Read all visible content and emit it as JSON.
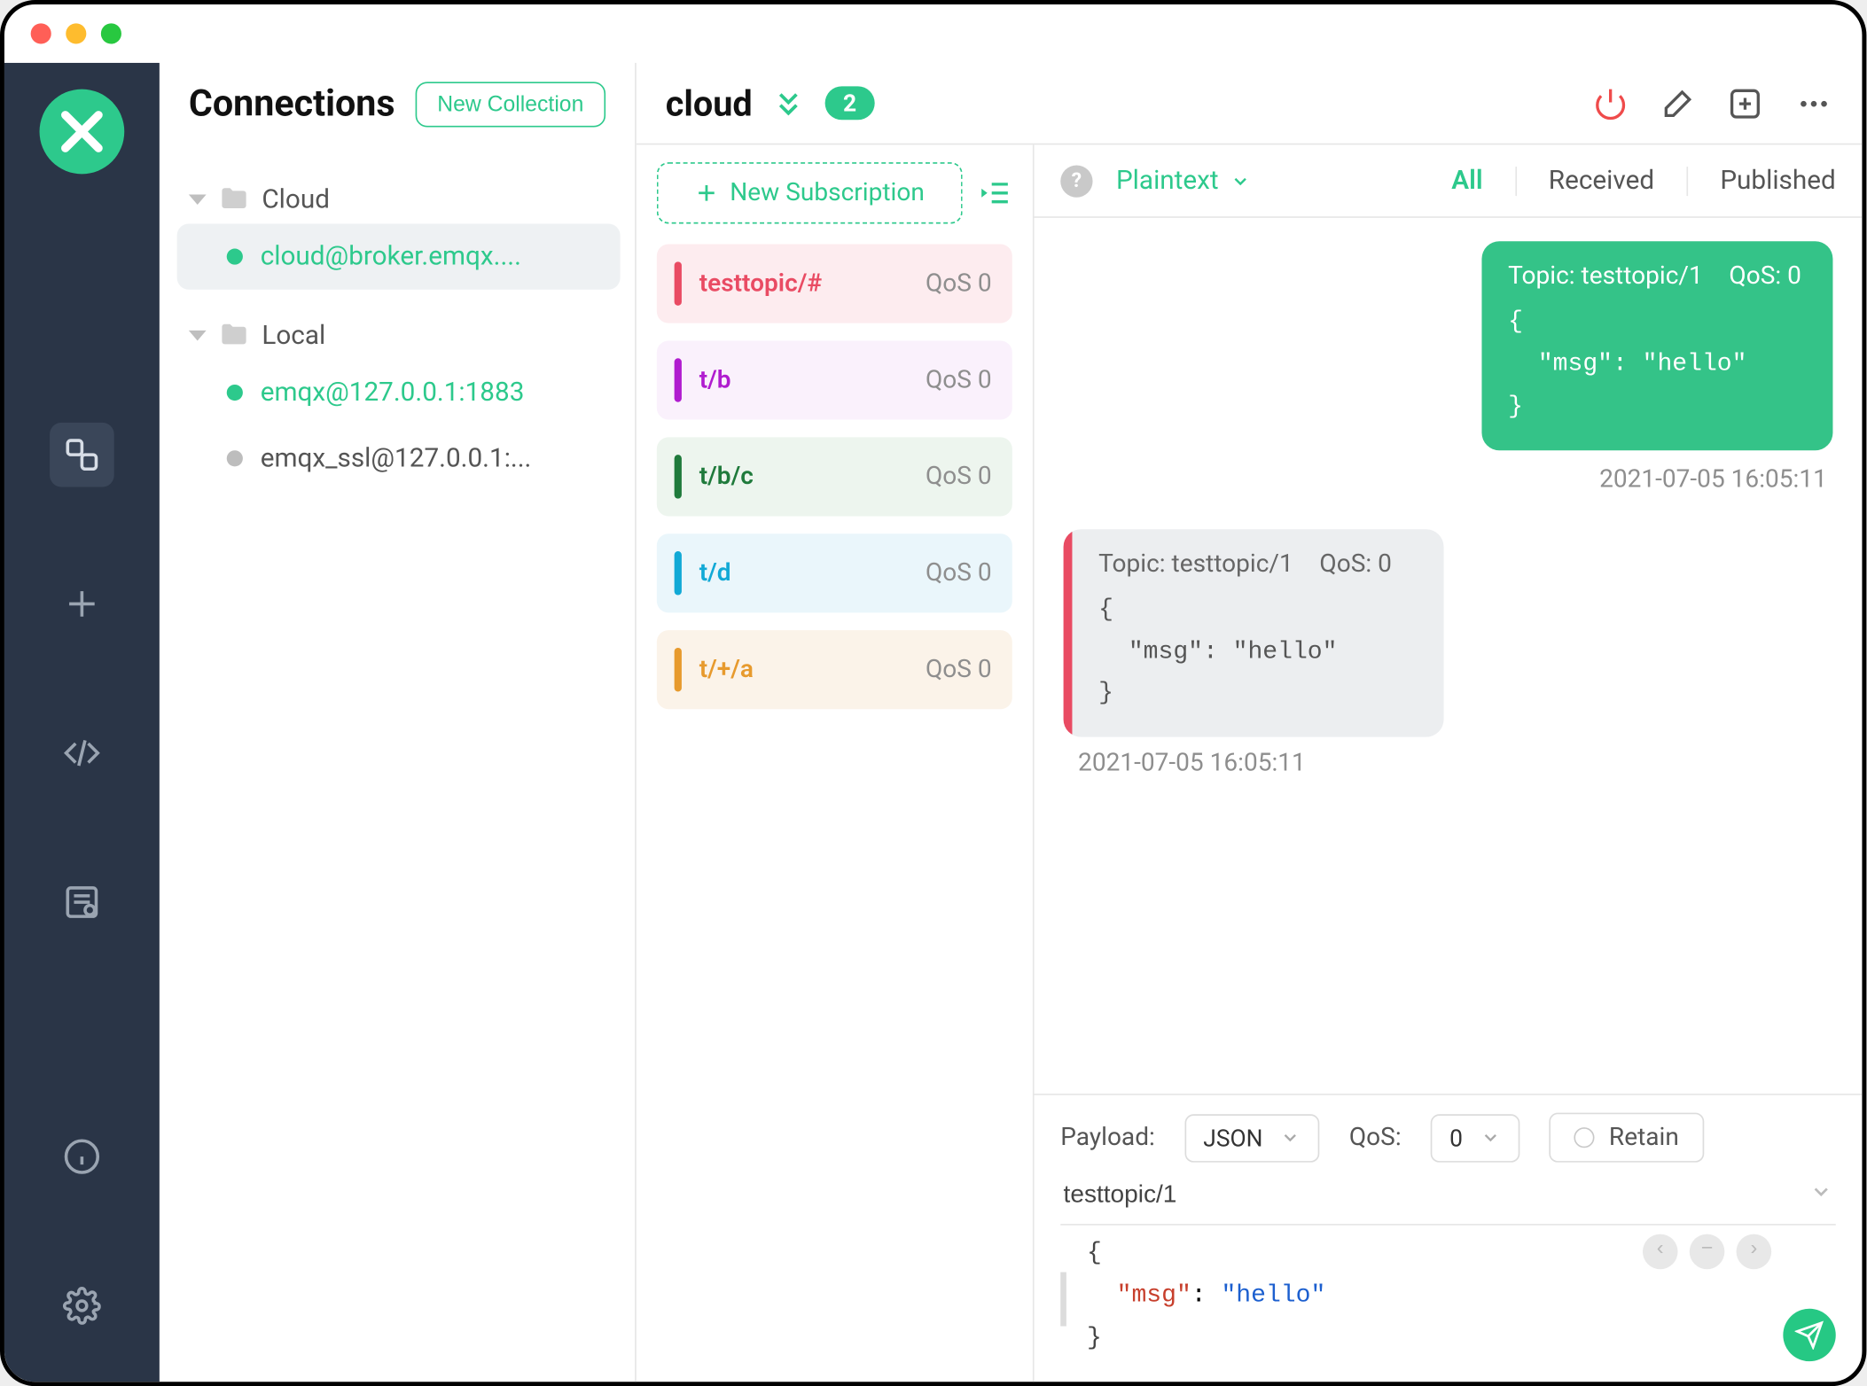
{
  "sidebar": {
    "title": "Connections",
    "new_collection": "New Collection",
    "groups": [
      {
        "name": "Cloud",
        "items": [
          {
            "label": "cloud@broker.emqx....",
            "state": "online",
            "active": true
          }
        ]
      },
      {
        "name": "Local",
        "items": [
          {
            "label": "emqx@127.0.0.1:1883",
            "state": "online",
            "active": false
          },
          {
            "label": "emqx_ssl@127.0.0.1:...",
            "state": "offline",
            "active": false
          }
        ]
      }
    ]
  },
  "topbar": {
    "connection_name": "cloud",
    "badge": "2"
  },
  "subscriptions": {
    "new_sub_label": "New Subscription",
    "items": [
      {
        "topic": "testtopic/#",
        "qos": "QoS 0"
      },
      {
        "topic": "t/b",
        "qos": "QoS 0"
      },
      {
        "topic": "t/b/c",
        "qos": "QoS 0"
      },
      {
        "topic": "t/d",
        "qos": "QoS 0"
      },
      {
        "topic": "t/+/a",
        "qos": "QoS 0"
      }
    ]
  },
  "messages": {
    "format": "Plaintext",
    "tabs": {
      "all": "All",
      "received": "Received",
      "published": "Published"
    },
    "published": {
      "topic_label": "Topic: testtopic/1",
      "qos_label": "QoS: 0",
      "payload": "{\n  \"msg\": \"hello\"\n}",
      "time": "2021-07-05 16:05:11"
    },
    "received": {
      "topic_label": "Topic: testtopic/1",
      "qos_label": "QoS: 0",
      "payload": "{\n  \"msg\": \"hello\"\n}",
      "time": "2021-07-05 16:05:11"
    }
  },
  "publish": {
    "payload_label": "Payload:",
    "payload_format": "JSON",
    "qos_label": "QoS:",
    "qos_value": "0",
    "retain_label": "Retain",
    "topic": "testtopic/1",
    "body": {
      "brace_open": "{",
      "key": "\"msg\"",
      "colon": ": ",
      "value": "\"hello\"",
      "brace_close": "}"
    }
  }
}
